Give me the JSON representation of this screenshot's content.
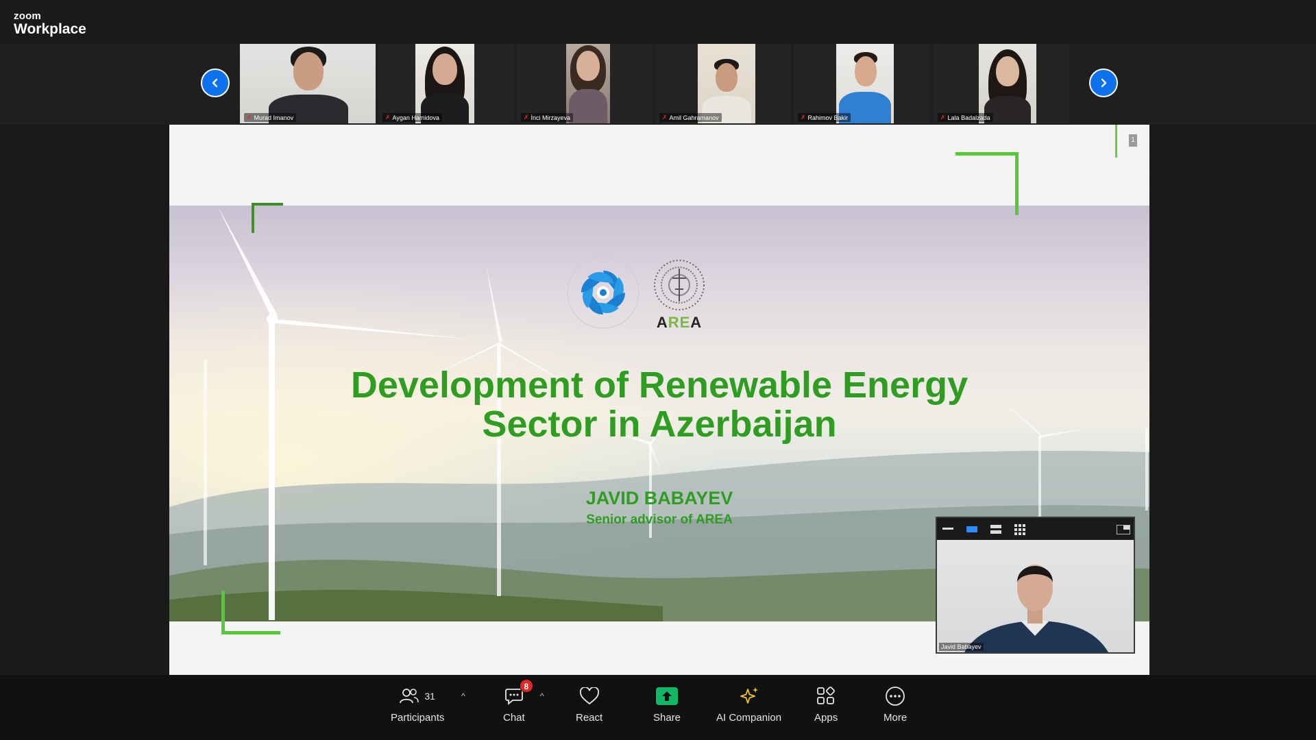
{
  "app": {
    "brand_top": "zoom",
    "brand_bottom": "Workplace"
  },
  "gallery": {
    "participants": [
      {
        "name": "Murad Imanov"
      },
      {
        "name": "Aygan Hamidova"
      },
      {
        "name": "İnci Mirzayeva"
      },
      {
        "name": "Amil Gahramanov"
      },
      {
        "name": "Rahimov Bakir"
      },
      {
        "name": "Lala Badalzada"
      }
    ],
    "prev_icon": "chevron-left-icon",
    "next_icon": "chevron-right-icon"
  },
  "slide": {
    "title_line1": "Development of Renewable Energy",
    "title_line2": "Sector in Azerbaijan",
    "presenter": "JAVID BABAYEV",
    "role": "Senior advisor of AREA",
    "logo_ministry": "THE REPUBLIC OF AZERBAIJAN MINISTRY OF ENERGY",
    "logo_area": "AREA",
    "page_number": "1",
    "accent_color": "#2f9d22"
  },
  "self_view": {
    "name": "Javid Babayev"
  },
  "toolbar": {
    "participants_label": "Participants",
    "participants_count": "31",
    "chat_label": "Chat",
    "chat_badge": "8",
    "react_label": "React",
    "share_label": "Share",
    "ai_label": "AI Companion",
    "apps_label": "Apps",
    "more_label": "More"
  },
  "colors": {
    "zoom_blue": "#0e72ed",
    "share_green": "#10b764",
    "badge_red": "#e02828",
    "ai_yellow": "#f5c518"
  }
}
